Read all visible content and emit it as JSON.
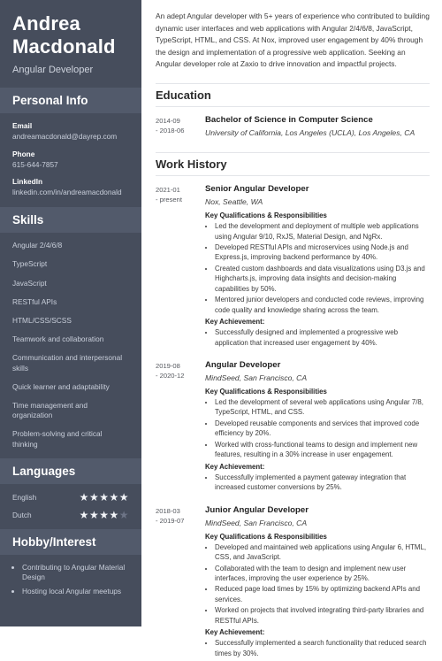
{
  "sidebar": {
    "first_name": "Andrea",
    "last_name": "Macdonald",
    "job_title": "Angular Developer",
    "personal_info": {
      "heading": "Personal Info",
      "items": [
        {
          "label": "Email",
          "value": "andreamacdonald@dayrep.com"
        },
        {
          "label": "Phone",
          "value": "615-644-7857"
        },
        {
          "label": "LinkedIn",
          "value": "linkedin.com/in/andreamacdonald"
        }
      ]
    },
    "skills": {
      "heading": "Skills",
      "items": [
        "Angular 2/4/6/8",
        "TypeScript",
        "JavaScript",
        "RESTful APIs",
        "HTML/CSS/SCSS",
        "Teamwork and collaboration",
        "Communication and interpersonal skills",
        "Quick learner and adaptability",
        "Time management and organization",
        "Problem-solving and critical thinking"
      ]
    },
    "languages": {
      "heading": "Languages",
      "items": [
        {
          "name": "English",
          "rating": 5,
          "max": 5
        },
        {
          "name": "Dutch",
          "rating": 4,
          "max": 5
        }
      ]
    },
    "hobby": {
      "heading": "Hobby/Interest",
      "items": [
        "Contributing to Angular Material Design",
        "Hosting local Angular meetups"
      ]
    }
  },
  "main": {
    "summary": "An adept Angular developer with 5+ years of experience who contributed to building dynamic user interfaces and web applications with Angular 2/4/6/8, JavaScript, TypeScript, HTML, and CSS. At Nox, improved user engagement by 40% through the design and implementation of a progressive web application. Seeking an Angular developer role at Zaxio to drive innovation and impactful projects.",
    "education": {
      "heading": "Education",
      "entries": [
        {
          "dates": "2014-09\n- 2018-06",
          "title": "Bachelor of Science in Computer Science",
          "subtitle": "University of California, Los Angeles (UCLA), Los Angeles, CA"
        }
      ]
    },
    "work_history": {
      "heading": "Work History",
      "entries": [
        {
          "dates": "2021-01\n- present",
          "title": "Senior Angular Developer",
          "subtitle": "Nox, Seattle, WA",
          "qual_heading": "Key Qualifications & Responsibilities",
          "qualifications": [
            "Led the development and deployment of multiple web applications using Angular 9/10, RxJS, Material Design, and NgRx.",
            "Developed RESTful APIs and microservices using Node.js and Express.js, improving backend performance by 40%.",
            "Created custom dashboards and data visualizations using D3.js and Highcharts.js, improving data insights and decision-making capabilities by 50%.",
            "Mentored junior developers and conducted code reviews, improving code quality and knowledge sharing across the team."
          ],
          "achievement_heading": "Key Achievement:",
          "achievements": [
            "Successfully designed and implemented a progressive web application that increased user engagement by 40%."
          ]
        },
        {
          "dates": "2019-08\n- 2020-12",
          "title": "Angular Developer",
          "subtitle": "MindSeed, San Francisco, CA",
          "qual_heading": "Key Qualifications & Responsibilities",
          "qualifications": [
            "Led the development of several web applications using Angular 7/8, TypeScript, HTML, and CSS.",
            "Developed reusable components and services that improved code efficiency by 20%.",
            "Worked with cross-functional teams to design and implement new features, resulting in a 30% increase in user engagement."
          ],
          "achievement_heading": "Key Achievement:",
          "achievements": [
            "Successfully implemented a payment gateway integration that increased customer conversions by 25%."
          ]
        },
        {
          "dates": "2018-03\n- 2019-07",
          "title": "Junior Angular Developer",
          "subtitle": "MindSeed, San Francisco, CA",
          "qual_heading": "Key Qualifications & Responsibilities",
          "qualifications": [
            "Developed and maintained web applications using Angular 6, HTML, CSS, and JavaScript.",
            "Collaborated with the team to design and implement new user interfaces, improving the user experience by 25%.",
            "Reduced page load times by 15% by optimizing backend APIs and services.",
            "Worked on projects that involved integrating third-party libraries and RESTful APIs."
          ],
          "achievement_heading": "Key Achievement:",
          "achievements": [
            "Successfully implemented a search functionality that reduced search times by 30%."
          ]
        }
      ]
    }
  },
  "theme": {
    "sidebar_bg": "#464d5c",
    "sidebar_head_bg": "#525a6b",
    "text_muted": "#c9cfdb",
    "star_on": "#f2f4f8",
    "star_off": "#6d7486",
    "divider": "#e3e5e9"
  }
}
